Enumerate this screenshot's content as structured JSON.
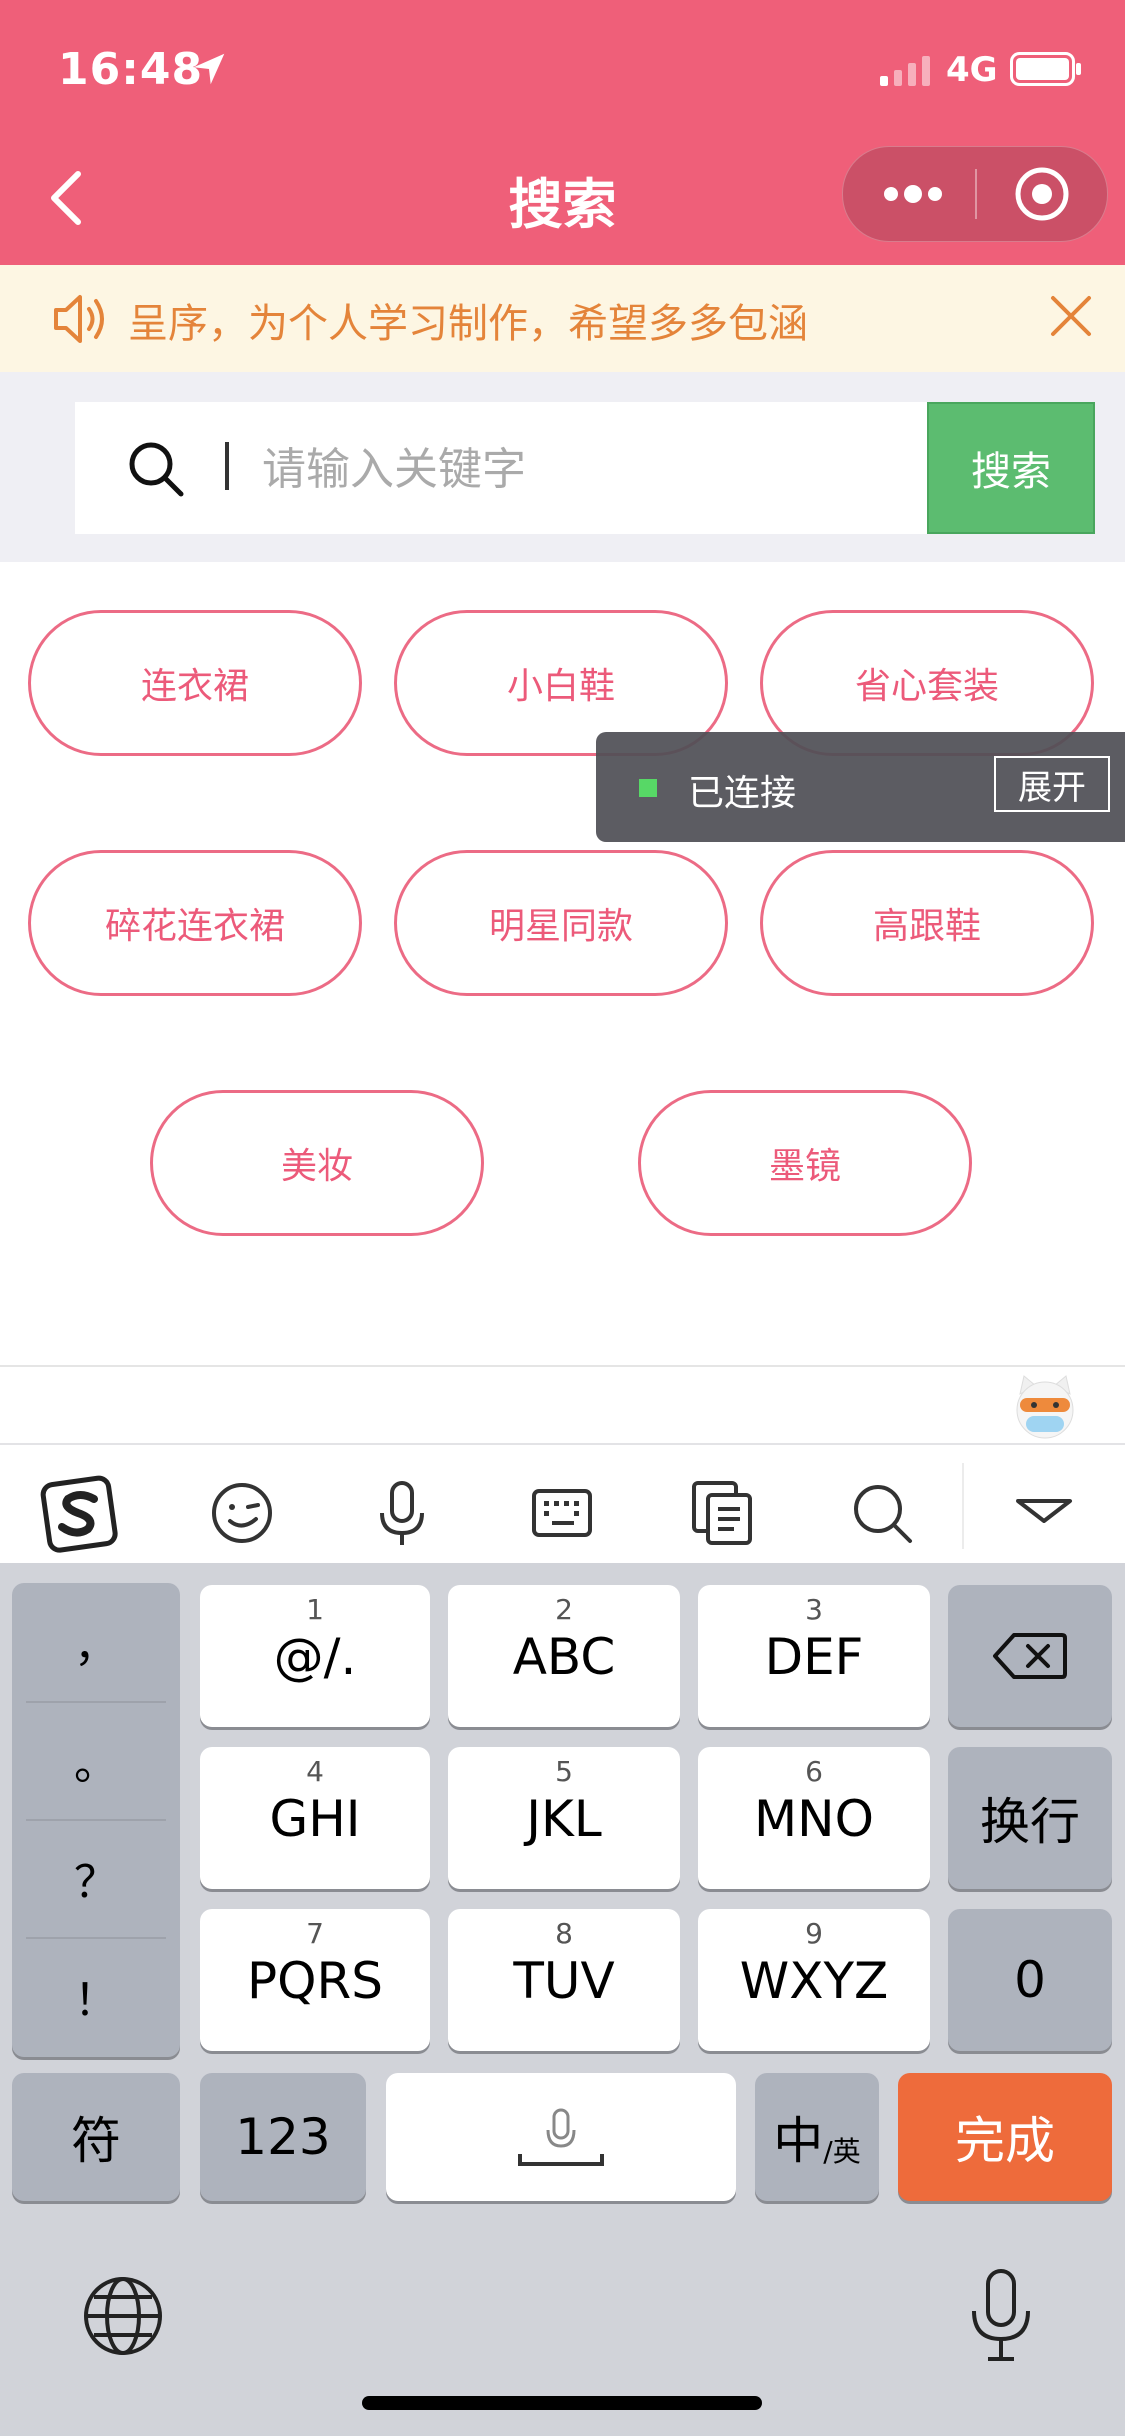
{
  "status": {
    "time": "16:48",
    "network": "4G"
  },
  "nav": {
    "title": "搜索"
  },
  "notice": {
    "text": "呈序，为个人学习制作，希望多多包涵"
  },
  "search": {
    "placeholder": "请输入关键字",
    "button_label": "搜索"
  },
  "tags": [
    "连衣裙",
    "小白鞋",
    "省心套装",
    "碎花连衣裙",
    "明星同款",
    "高跟鞋",
    "美妆",
    "墨镜"
  ],
  "overlay": {
    "status": "已连接",
    "button_label": "展开"
  },
  "keyboard": {
    "punctuation": [
      "，",
      "。",
      "？",
      "！"
    ],
    "keys": [
      {
        "num": "1",
        "label": "@/."
      },
      {
        "num": "2",
        "label": "ABC"
      },
      {
        "num": "3",
        "label": "DEF"
      },
      {
        "num": "4",
        "label": "GHI"
      },
      {
        "num": "5",
        "label": "JKL"
      },
      {
        "num": "6",
        "label": "MNO"
      },
      {
        "num": "7",
        "label": "PQRS"
      },
      {
        "num": "8",
        "label": "TUV"
      },
      {
        "num": "9",
        "label": "WXYZ"
      }
    ],
    "newline": "换行",
    "zero": "0",
    "symbols": "符",
    "numbers": "123",
    "lang_main": "中",
    "lang_sub": "/英",
    "done": "完成"
  },
  "colors": {
    "brand": "#ef5f79",
    "search_button": "#5cbc70",
    "done_key": "#ee6b3b",
    "notice_text": "#e4843a"
  }
}
